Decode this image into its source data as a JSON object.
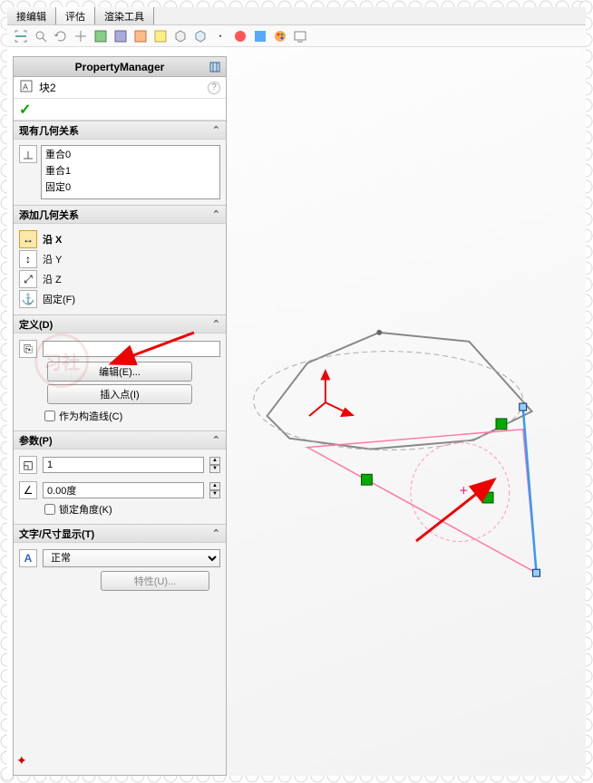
{
  "tabs": [
    "接编辑",
    "评估",
    "渲染工具"
  ],
  "panel": {
    "title": "PropertyManager"
  },
  "feature": {
    "name": "块2",
    "help": "?"
  },
  "sections": {
    "existing": {
      "title": "现有几何关系",
      "items": [
        "重合0",
        "重合1",
        "固定0"
      ]
    },
    "add": {
      "title": "添加几何关系",
      "opts": [
        "沿 X",
        "沿 Y",
        "沿 Z",
        "固定(F)"
      ]
    },
    "define": {
      "title": "定义(D)",
      "edit_btn": "编辑(E)...",
      "insert_btn": "插入点(I)",
      "construction": "作为构造线(C)"
    },
    "params": {
      "title": "参数(P)",
      "scale": "1",
      "angle": "0.00度",
      "lock_angle": "锁定角度(K)"
    },
    "text": {
      "title": "文字/尺寸显示(T)",
      "value": "正常",
      "props_btn": "特性(U)..."
    }
  }
}
